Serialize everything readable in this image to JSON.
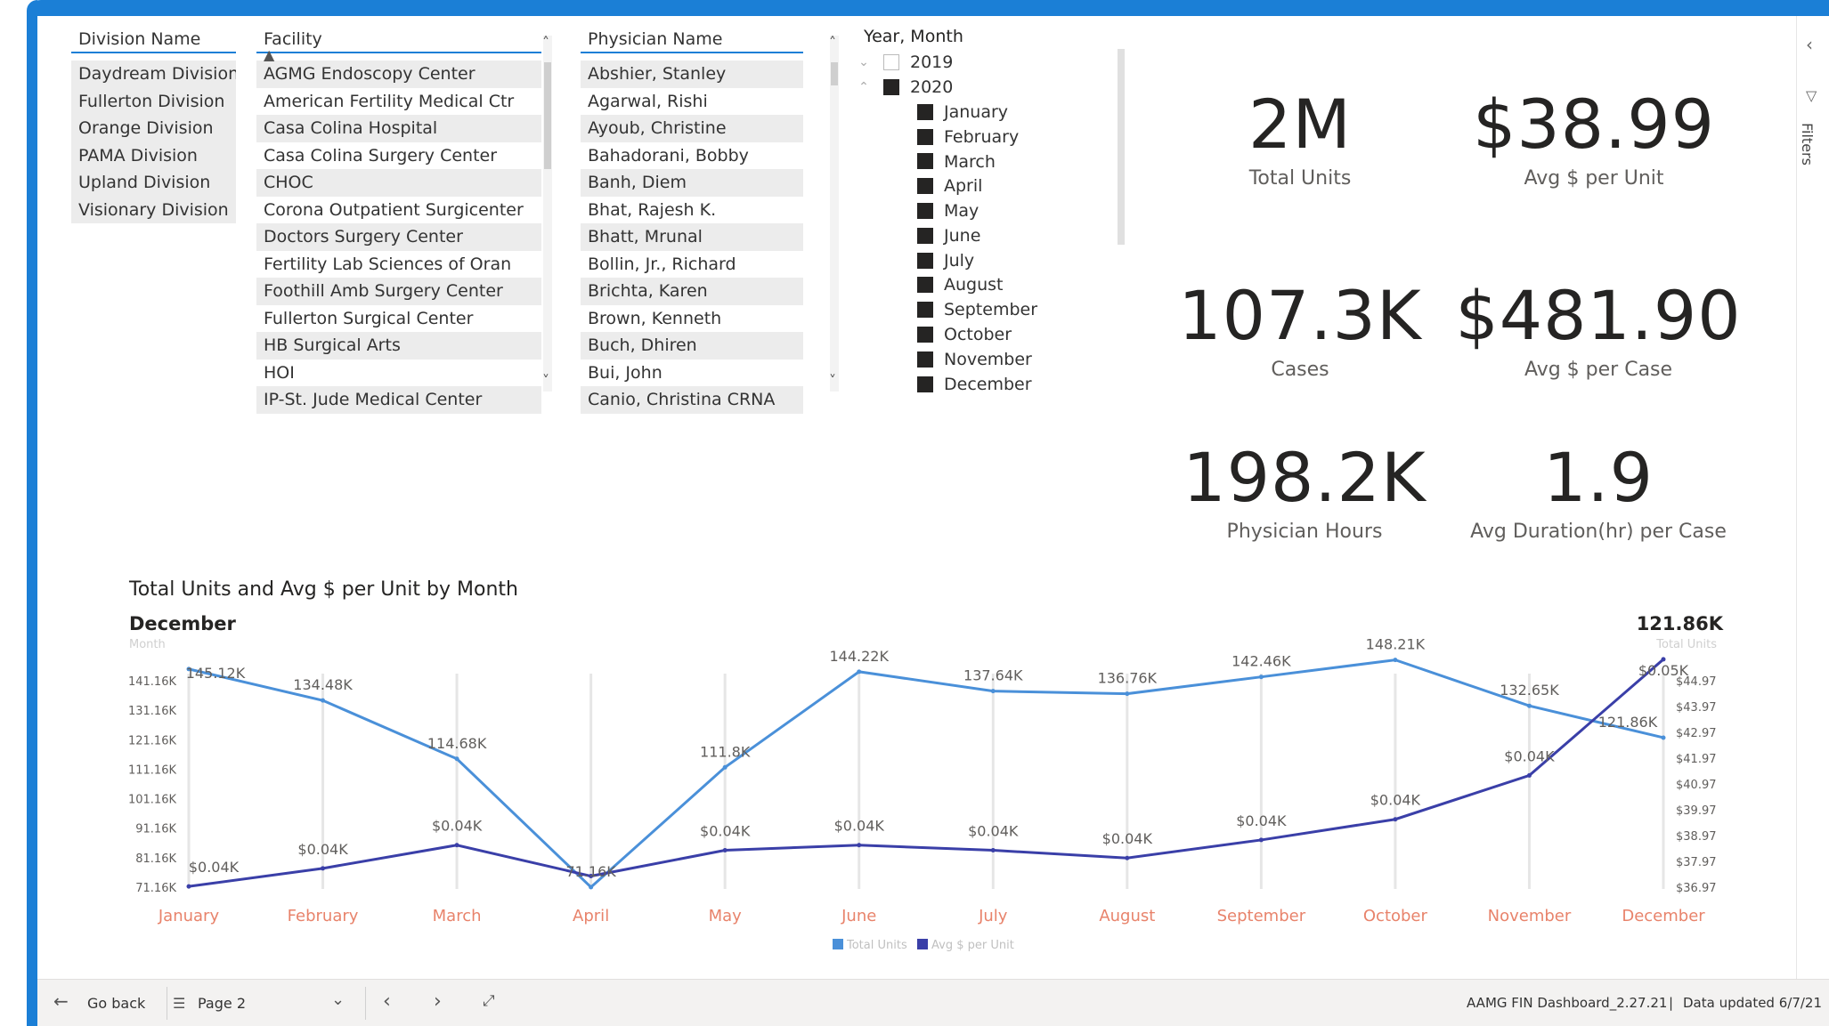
{
  "slicers": {
    "division": {
      "header": "Division Name",
      "items": [
        "Daydream Division",
        "Fullerton Division",
        "Orange Division",
        "PAMA Division",
        "Upland Division",
        "Visionary Division"
      ]
    },
    "facility": {
      "header": "Facility",
      "items": [
        "AGMG Endoscopy Center",
        "American Fertility Medical Ctr",
        "Casa Colina Hospital",
        "Casa Colina Surgery Center",
        "CHOC",
        "Corona Outpatient Surgicenter",
        "Doctors Surgery Center",
        "Fertility Lab Sciences of Oran",
        "Foothill Amb Surgery Center",
        "Fullerton Surgical Center",
        "HB Surgical Arts",
        "HOI",
        "IP-St. Jude Medical Center"
      ]
    },
    "physician": {
      "header": "Physician Name",
      "items": [
        "Abshier, Stanley",
        "Agarwal, Rishi",
        "Ayoub, Christine",
        "Bahadorani, Bobby",
        "Banh, Diem",
        "Bhat, Rajesh K.",
        "Bhatt, Mrunal",
        "Bollin, Jr., Richard",
        "Brichta, Karen",
        "Brown, Kenneth",
        "Buch, Dhiren",
        "Bui, John",
        "Canio, Christina CRNA"
      ]
    },
    "yearmonth": {
      "header": "Year, Month",
      "years": [
        "2019",
        "2020"
      ],
      "months": [
        "January",
        "February",
        "March",
        "April",
        "May",
        "June",
        "July",
        "August",
        "September",
        "October",
        "November",
        "December"
      ]
    }
  },
  "cards": {
    "total_units": {
      "value": "2M",
      "label": "Total Units"
    },
    "avg_per_unit": {
      "value": "$38.99",
      "label": "Avg $ per Unit"
    },
    "cases": {
      "value": "107.3K",
      "label": "Cases"
    },
    "avg_per_case": {
      "value": "$481.90",
      "label": "Avg $ per Case"
    },
    "physician_hours": {
      "value": "198.2K",
      "label": "Physician Hours"
    },
    "avg_duration": {
      "value": "1.9",
      "label": "Avg Duration(hr) per Case"
    }
  },
  "chart_title": "Total Units and Avg $ per Unit by Month",
  "chart_data": {
    "type": "line",
    "title": "Total Units and Avg $ per Unit by Month",
    "categories": [
      "January",
      "February",
      "March",
      "April",
      "May",
      "June",
      "July",
      "August",
      "September",
      "October",
      "November",
      "December"
    ],
    "series": [
      {
        "name": "Total Units",
        "axis": "left",
        "values": [
          145120,
          134480,
          114680,
          71160,
          111800,
          144220,
          137640,
          136760,
          142460,
          148210,
          132650,
          121860
        ],
        "labels": [
          "145.12K",
          "134.48K",
          "114.68K",
          "71.16K",
          "111.8K",
          "144.22K",
          "137.64K",
          "136.76K",
          "142.46K",
          "148.21K",
          "132.65K",
          "121.86K"
        ]
      },
      {
        "name": "Avg $ per Unit",
        "axis": "right",
        "values": [
          37.0,
          37.7,
          38.6,
          37.4,
          38.4,
          38.6,
          38.4,
          38.1,
          38.8,
          39.6,
          41.3,
          45.8
        ],
        "labels": [
          "$0.04K",
          "$0.04K",
          "$0.04K",
          "",
          "$0.04K",
          "$0.04K",
          "$0.04K",
          "$0.04K",
          "$0.04K",
          "$0.04K",
          "$0.04K",
          "$0.05K"
        ]
      }
    ],
    "left_ticks": [
      "71.16K",
      "81.16K",
      "91.16K",
      "101.16K",
      "111.16K",
      "121.16K",
      "131.16K",
      "141.16K"
    ],
    "left_range": [
      71160,
      141160
    ],
    "right_ticks": [
      "$36.97",
      "$37.97",
      "$38.97",
      "$39.97",
      "$40.97",
      "$41.97",
      "$42.97",
      "$43.97",
      "$44.97"
    ],
    "right_range": [
      36.97,
      44.97
    ],
    "tooltip_left_title": "December",
    "tooltip_left_sub": "Month",
    "tooltip_right_title": "121.86K",
    "tooltip_right_sub": "Total Units",
    "legend_placement": "bottom-center",
    "colors": {
      "total_units": "#4a90d9",
      "avg_per_unit": "#3a3fa8",
      "month_label": "#e8836b"
    }
  },
  "bottom": {
    "go_back": "Go back",
    "page": "Page 2",
    "file": "AAMG FIN Dashboard_2.27.21",
    "updated": "Data updated 6/7/21"
  },
  "filters_label": "Filters"
}
